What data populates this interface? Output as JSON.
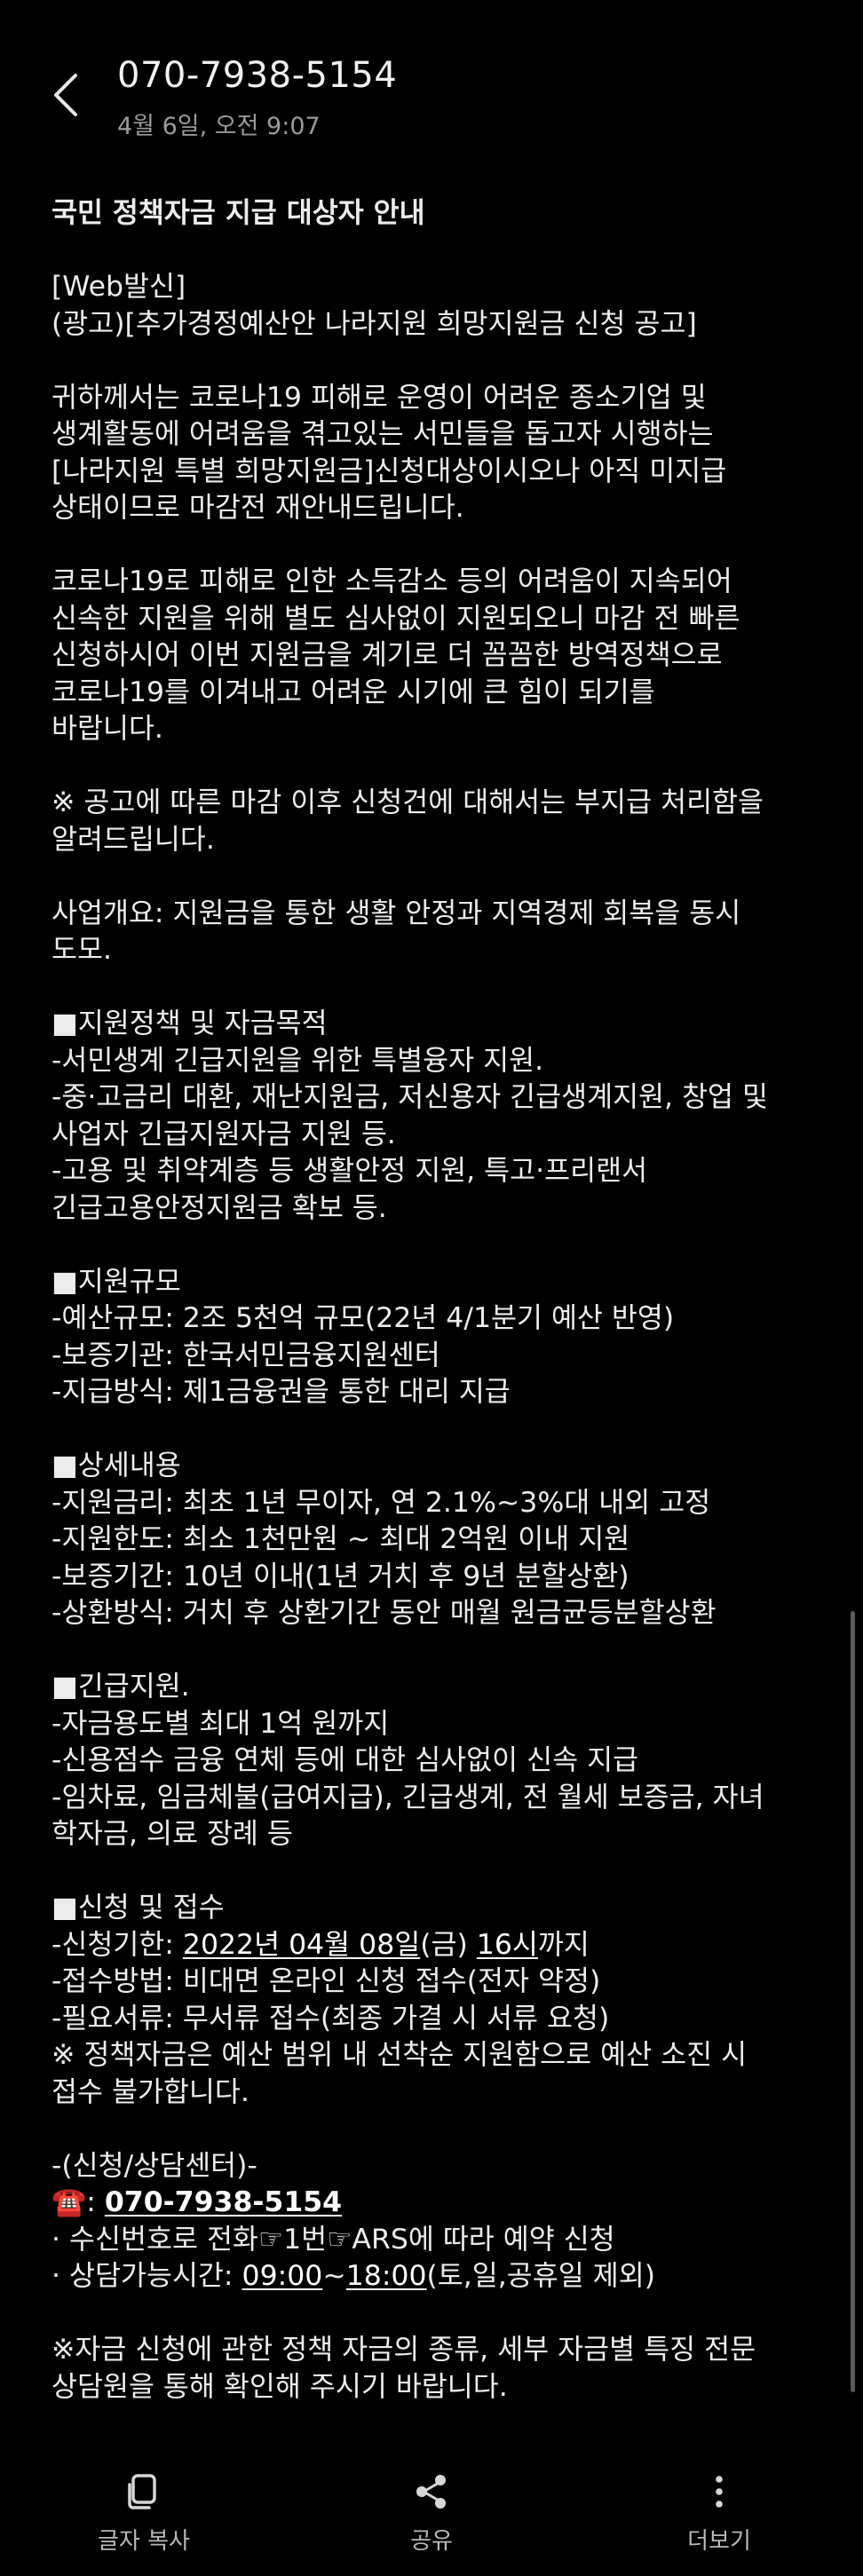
{
  "header": {
    "sender": "070-7938-5154",
    "timestamp": "4월 6일, 오전 9:07"
  },
  "message": {
    "lines": [
      {
        "segments": [
          {
            "t": "국민 정책자금 지급 대상자 안내",
            "bold": true
          }
        ]
      },
      {
        "segments": []
      },
      {
        "segments": [
          {
            "t": "[Web발신]"
          }
        ]
      },
      {
        "segments": [
          {
            "t": "(광고)[추가경정예산안 나라지원 희망지원금 신청 공고]"
          }
        ]
      },
      {
        "segments": []
      },
      {
        "segments": [
          {
            "t": "귀하께서는 코로나19 피해로 운영이 어려운 종소기업 및"
          }
        ]
      },
      {
        "segments": [
          {
            "t": "생계활동에 어려움을 겪고있는 서민들을 돕고자 시행하는"
          }
        ]
      },
      {
        "segments": [
          {
            "t": "[나라지원 특별 희망지원금]신청대상이시오나 아직 미지급"
          }
        ]
      },
      {
        "segments": [
          {
            "t": "상태이므로 마감전 재안내드립니다."
          }
        ]
      },
      {
        "segments": []
      },
      {
        "segments": [
          {
            "t": "코로나19로 피해로 인한 소득감소 등의 어려움이 지속되어"
          }
        ]
      },
      {
        "segments": [
          {
            "t": "신속한 지원을 위해 별도 심사없이 지원되오니 마감 전 빠른"
          }
        ]
      },
      {
        "segments": [
          {
            "t": "신청하시어 이번 지원금을 계기로 더 꼼꼼한 방역정책으로"
          }
        ]
      },
      {
        "segments": [
          {
            "t": "코로나19를 이겨내고 어려운 시기에 큰 힘이 되기를"
          }
        ]
      },
      {
        "segments": [
          {
            "t": "바랍니다."
          }
        ]
      },
      {
        "segments": []
      },
      {
        "segments": [
          {
            "t": "※ 공고에 따른 마감 이후 신청건에 대해서는 부지급 처리함을"
          }
        ]
      },
      {
        "segments": [
          {
            "t": "알려드립니다."
          }
        ]
      },
      {
        "segments": []
      },
      {
        "segments": [
          {
            "t": "사업개요: 지원금을 통한 생활 안정과 지역경제 회복을 동시"
          }
        ]
      },
      {
        "segments": [
          {
            "t": "도모."
          }
        ]
      },
      {
        "segments": []
      },
      {
        "segments": [
          {
            "t": "■지원정책 및 자금목적"
          }
        ]
      },
      {
        "segments": [
          {
            "t": "-서민생계 긴급지원을 위한 특별융자 지원."
          }
        ]
      },
      {
        "segments": [
          {
            "t": "-중·고금리 대환, 재난지원금, 저신용자 긴급생계지원, 창업 및"
          }
        ]
      },
      {
        "segments": [
          {
            "t": "사업자 긴급지원자금 지원 등."
          }
        ]
      },
      {
        "segments": [
          {
            "t": "-고용 및 취약계층 등 생활안정 지원, 특고·프리랜서"
          }
        ]
      },
      {
        "segments": [
          {
            "t": "긴급고용안정지원금 확보 등."
          }
        ]
      },
      {
        "segments": []
      },
      {
        "segments": [
          {
            "t": "■지원규모"
          }
        ]
      },
      {
        "segments": [
          {
            "t": "-예산규모: 2조 5천억 규모(22년 4/1분기 예산 반영)"
          }
        ]
      },
      {
        "segments": [
          {
            "t": "-보증기관: 한국서민금융지원센터"
          }
        ]
      },
      {
        "segments": [
          {
            "t": "-지급방식: 제1금융권을 통한 대리 지급"
          }
        ]
      },
      {
        "segments": []
      },
      {
        "segments": [
          {
            "t": "■상세내용"
          }
        ]
      },
      {
        "segments": [
          {
            "t": "-지원금리: 최초 1년 무이자, 연 2.1%~3%대 내외 고정"
          }
        ]
      },
      {
        "segments": [
          {
            "t": "-지원한도: 최소 1천만원 ~ 최대 2억원 이내 지원"
          }
        ]
      },
      {
        "segments": [
          {
            "t": "-보증기간: 10년 이내(1년 거치 후 9년 분할상환)"
          }
        ]
      },
      {
        "segments": [
          {
            "t": "-상환방식: 거치 후 상환기간 동안 매월 원금균등분할상환"
          }
        ]
      },
      {
        "segments": []
      },
      {
        "segments": [
          {
            "t": "■긴급지원."
          }
        ]
      },
      {
        "segments": [
          {
            "t": "-자금용도별 최대 1억 원까지"
          }
        ]
      },
      {
        "segments": [
          {
            "t": "-신용점수 금융 연체 등에 대한 심사없이 신속 지급"
          }
        ]
      },
      {
        "segments": [
          {
            "t": "-임차료, 임금체불(급여지급), 긴급생계, 전 월세 보증금, 자녀"
          }
        ]
      },
      {
        "segments": [
          {
            "t": "학자금, 의료 장례 등"
          }
        ]
      },
      {
        "segments": []
      },
      {
        "segments": [
          {
            "t": "■신청 및 접수"
          }
        ]
      },
      {
        "segments": [
          {
            "t": "-신청기한: "
          },
          {
            "t": "2022년 04월 08일",
            "u": true
          },
          {
            "t": "(금) "
          },
          {
            "t": "16시",
            "u": true
          },
          {
            "t": "까지"
          }
        ]
      },
      {
        "segments": [
          {
            "t": "-접수방법: 비대면 온라인 신청 접수(전자 약정)"
          }
        ]
      },
      {
        "segments": [
          {
            "t": "-필요서류: 무서류 접수(최종 가결 시 서류 요청)"
          }
        ]
      },
      {
        "segments": [
          {
            "t": "※ 정책자금은 예산 범위 내 선착순 지원함으로 예산 소진 시"
          }
        ]
      },
      {
        "segments": [
          {
            "t": "접수 불가합니다."
          }
        ]
      },
      {
        "segments": []
      },
      {
        "segments": [
          {
            "t": "-(신청/상담센터)-"
          }
        ]
      },
      {
        "segments": [
          {
            "t": "☎️: "
          },
          {
            "t": "070-7938-5154",
            "u": true,
            "bold": true
          }
        ]
      },
      {
        "segments": [
          {
            "t": "· 수신번호로 전화☞1번☞ARS에 따라 예약 신청"
          }
        ]
      },
      {
        "segments": [
          {
            "t": "· 상담가능시간: "
          },
          {
            "t": "09:00",
            "u": true
          },
          {
            "t": "~"
          },
          {
            "t": "18:00",
            "u": true
          },
          {
            "t": "(토,일,공휴일 제외)"
          }
        ]
      },
      {
        "segments": []
      },
      {
        "segments": [
          {
            "t": "※자금 신청에 관한 정책 자금의 종류, 세부 자금별 특징 전문"
          }
        ]
      },
      {
        "segments": [
          {
            "t": "상담원을 통해 확인해 주시기 바랍니다."
          }
        ]
      }
    ]
  },
  "bottom_bar": {
    "copy_label": "글자 복사",
    "share_label": "공유",
    "more_label": "더보기"
  },
  "icons": {
    "back": "back-arrow-icon",
    "copy": "copy-icon",
    "share": "share-icon",
    "more": "more-vertical-icon"
  }
}
